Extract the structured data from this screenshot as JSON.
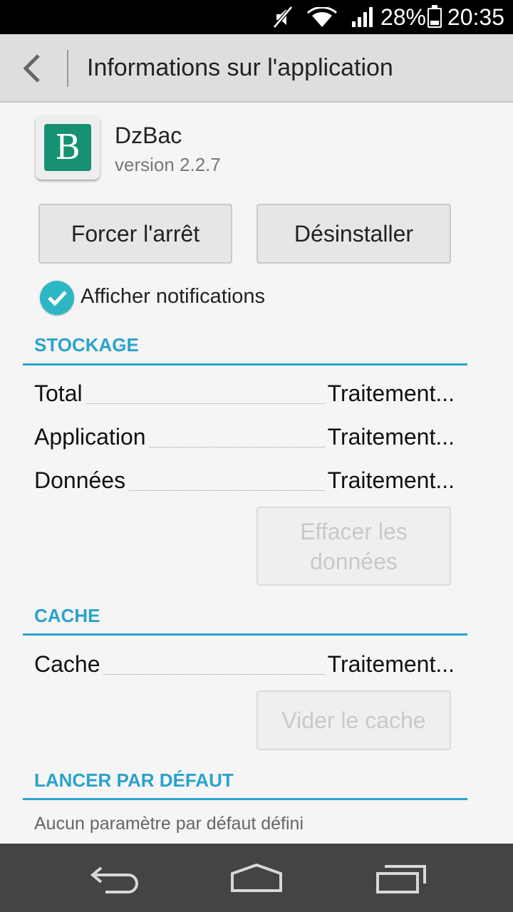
{
  "status_bar": {
    "battery_percent": "28%",
    "time": "20:35",
    "icons": [
      "mute-icon",
      "wifi-icon",
      "signal-icon",
      "battery-icon"
    ]
  },
  "action_bar": {
    "title": "Informations sur l'application",
    "back_icon": "chevron-left-icon"
  },
  "app": {
    "name": "DzBac",
    "version": "version 2.2.7",
    "icon_letter": "B",
    "icon_color": "#169171"
  },
  "buttons": {
    "force_stop": "Forcer l'arrêt",
    "uninstall": "Désinstaller"
  },
  "notifications": {
    "label": "Afficher notifications",
    "checked": true
  },
  "storage": {
    "title": "STOCKAGE",
    "rows": [
      {
        "label": "Total",
        "value": "Traitement..."
      },
      {
        "label": "Application",
        "value": "Traitement..."
      },
      {
        "label": "Données",
        "value": "Traitement..."
      }
    ],
    "clear_data_line1": "Effacer les",
    "clear_data_line2": "données"
  },
  "cache": {
    "title": "CACHE",
    "rows": [
      {
        "label": "Cache",
        "value": "Traitement..."
      }
    ],
    "clear_cache": "Vider le cache"
  },
  "launch_default": {
    "title": "LANCER PAR DÉFAUT",
    "text": "Aucun paramètre par défaut défini"
  },
  "nav_bar": {
    "icons": [
      "back-icon",
      "home-icon",
      "recents-icon"
    ]
  },
  "colors": {
    "accent": "#29a3cc",
    "check": "#2db7c4"
  }
}
